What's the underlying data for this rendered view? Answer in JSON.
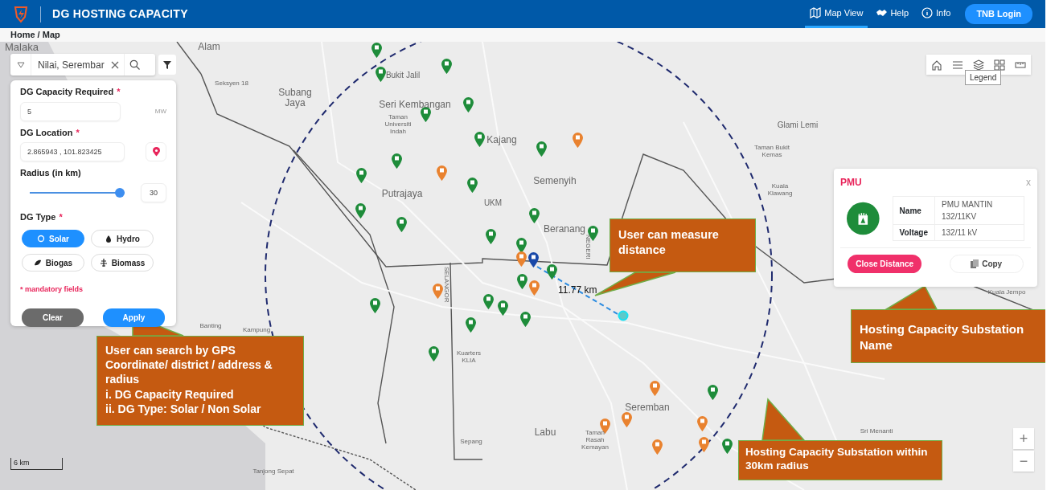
{
  "header": {
    "title": "DG HOSTING CAPACITY",
    "nav": [
      {
        "label": "Map View",
        "kind": "map",
        "selected": true
      },
      {
        "label": "Help",
        "kind": "help",
        "selected": false
      },
      {
        "label": "Info",
        "kind": "info",
        "selected": false
      }
    ],
    "login": "TNB Login"
  },
  "breadcrumb": "Home / Map",
  "search": {
    "value": "Nilai, Serembar"
  },
  "form": {
    "capacity": {
      "label": "DG Capacity Required",
      "mark": "*",
      "value": "5",
      "unit": "MW"
    },
    "location": {
      "label": "DG Location",
      "mark": "*",
      "value": "2.865943 , 101.823425"
    },
    "radius": {
      "label": "Radius (in km)",
      "level": 1,
      "value": "30"
    },
    "dg_type": {
      "label": "DG Type",
      "mark": "*",
      "options": [
        {
          "label": "Solar",
          "kind": "solar",
          "selected": true
        },
        {
          "label": "Hydro",
          "kind": "hydro",
          "selected": false
        },
        {
          "label": "Biogas",
          "kind": "biogas",
          "selected": false
        },
        {
          "label": "Biomass",
          "kind": "biomass",
          "selected": false
        }
      ]
    },
    "note": "* mandatory fields",
    "buttons": [
      {
        "label": "Clear",
        "kind": "secondary"
      },
      {
        "label": "Apply",
        "kind": "primary"
      }
    ]
  },
  "map_tools": [
    {
      "kind": "home"
    },
    {
      "kind": "list"
    },
    {
      "kind": "layers"
    },
    {
      "kind": "grid"
    },
    {
      "kind": "ruler"
    }
  ],
  "tooltip": "Legend",
  "places": [
    "Malaka",
    "Alam",
    "Seksyen 18",
    "Subang Jaya",
    "Bukit Jalil",
    "Seri Kembangan",
    "Taman Universiti Indah",
    "Kajang",
    "Putrajaya",
    "UKM",
    "Semenyih",
    "Beranang",
    "Glami Lemi",
    "Taman Bukit Kemas",
    "Kuala Klawang",
    "Kuala Jempo",
    "Banting",
    "Kampung",
    "Kuarters KLIA",
    "Seremban",
    "Labu",
    "Sepang",
    "Taman Rasah Kemayan",
    "Tanjong Sepat",
    "Sri Menanti",
    "SELANGOR",
    "NEGERI"
  ],
  "pins": [
    {
      "color": "#1e8c3a"
    },
    {
      "color": "#1e8c3a"
    },
    {
      "color": "#1e8c3a"
    },
    {
      "color": "#1e8c3a"
    },
    {
      "color": "#1e8c3a"
    },
    {
      "color": "#1e8c3a"
    },
    {
      "color": "#1e8c3a"
    },
    {
      "color": "#1e8c3a"
    },
    {
      "color": "#1e8c3a"
    },
    {
      "color": "#1e8c3a"
    },
    {
      "color": "#1e8c3a"
    },
    {
      "color": "#1e8c3a"
    },
    {
      "color": "#1e8c3a"
    },
    {
      "color": "#1e8c3a"
    },
    {
      "color": "#1e8c3a"
    },
    {
      "color": "#1e8c3a"
    },
    {
      "color": "#1e8c3a"
    },
    {
      "color": "#1e8c3a"
    },
    {
      "color": "#1e8c3a"
    },
    {
      "color": "#1e8c3a"
    },
    {
      "color": "#1e8c3a"
    },
    {
      "color": "#1e8c3a"
    },
    {
      "color": "#1e8c3a"
    },
    {
      "color": "#1e8c3a"
    },
    {
      "color": "#1e8c3a"
    },
    {
      "color": "#1e8c3a"
    },
    {
      "color": "#e9822f"
    },
    {
      "color": "#e9822f"
    },
    {
      "color": "#e9822f"
    },
    {
      "color": "#e9822f"
    },
    {
      "color": "#e9822f"
    },
    {
      "color": "#e9822f"
    },
    {
      "color": "#e9822f"
    },
    {
      "color": "#e9822f"
    },
    {
      "color": "#e9822f"
    },
    {
      "color": "#e9822f"
    },
    {
      "color": "#e9822f"
    },
    {
      "color": "#1848a8"
    }
  ],
  "distance": "11.77 km",
  "popup": {
    "title": "PMU",
    "close": "x",
    "rows": [
      {
        "label": "Name",
        "value": "PMU MANTIN 132/11KV"
      },
      {
        "label": "Voltage",
        "value": "132/11 kV"
      }
    ],
    "buttons": [
      {
        "label": "Close Distance",
        "kind": "danger"
      },
      {
        "label": "Copy",
        "kind": "copy"
      }
    ]
  },
  "callouts": [
    {
      "lines": [
        "User can measure distance"
      ]
    },
    {
      "lines": [
        "Hosting Capacity Substation Name"
      ]
    },
    {
      "lines": [
        "User can search by GPS Coordinate/ district / address & radius",
        "i. DG Capacity Required",
        "ii. DG Type: Solar / Non Solar"
      ]
    },
    {
      "lines": [
        "Hosting Capacity Substation within  30km radius"
      ]
    }
  ],
  "scale": "6 km",
  "zoom": [
    "+",
    "−"
  ]
}
